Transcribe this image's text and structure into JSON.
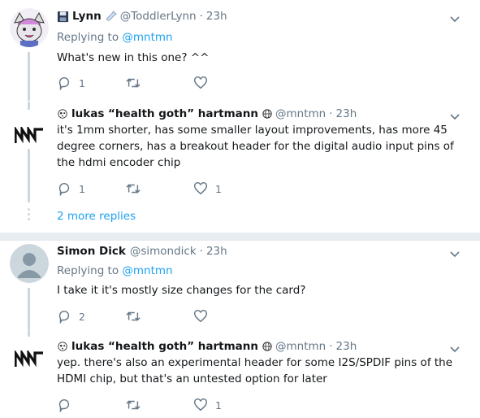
{
  "tweets": [
    {
      "name": "Lynn",
      "handle": "@ToddlerLynn",
      "time": "23h",
      "reply_label": "Replying to",
      "reply_mention": "@mntmn",
      "text": "What's new in this one? ^^",
      "reply_count": "1",
      "retweet_count": "",
      "like_count": "",
      "name_icon_left": "floppy-disk-icon",
      "name_icon_right": "baby-bottle-icon"
    },
    {
      "name": "lukas “health goth” hartmann",
      "handle": "@mntmn",
      "time": "23h",
      "text": "it's 1mm shorter, has some smaller layout improvements, has more 45 degree corners, has a breakout header for the digital audio input pins of the hdmi encoder chip",
      "reply_count": "1",
      "retweet_count": "",
      "like_count": "1",
      "name_icon_left": "alien-icon",
      "name_icon_right": "globe-icon"
    },
    {
      "name": "Simon Dick",
      "handle": "@simondick",
      "time": "23h",
      "reply_label": "Replying to",
      "reply_mention": "@mntmn",
      "text": "I take it it's mostly size changes for the card?",
      "reply_count": "2",
      "retweet_count": "",
      "like_count": ""
    },
    {
      "name": "lukas “health goth” hartmann",
      "handle": "@mntmn",
      "time": "23h",
      "text": "yep. there's also an experimental header for some I2S/SPDIF pins of the HDMI chip, but that's an untested option for later",
      "reply_count": "",
      "retweet_count": "",
      "like_count": "1",
      "name_icon_left": "alien-icon",
      "name_icon_right": "globe-icon"
    }
  ],
  "more_replies": "2 more replies",
  "colors": {
    "link": "#1da1f2",
    "muted": "#657786",
    "text": "#14171a",
    "line": "#ccd6dd",
    "divider": "#e6ecf0"
  }
}
